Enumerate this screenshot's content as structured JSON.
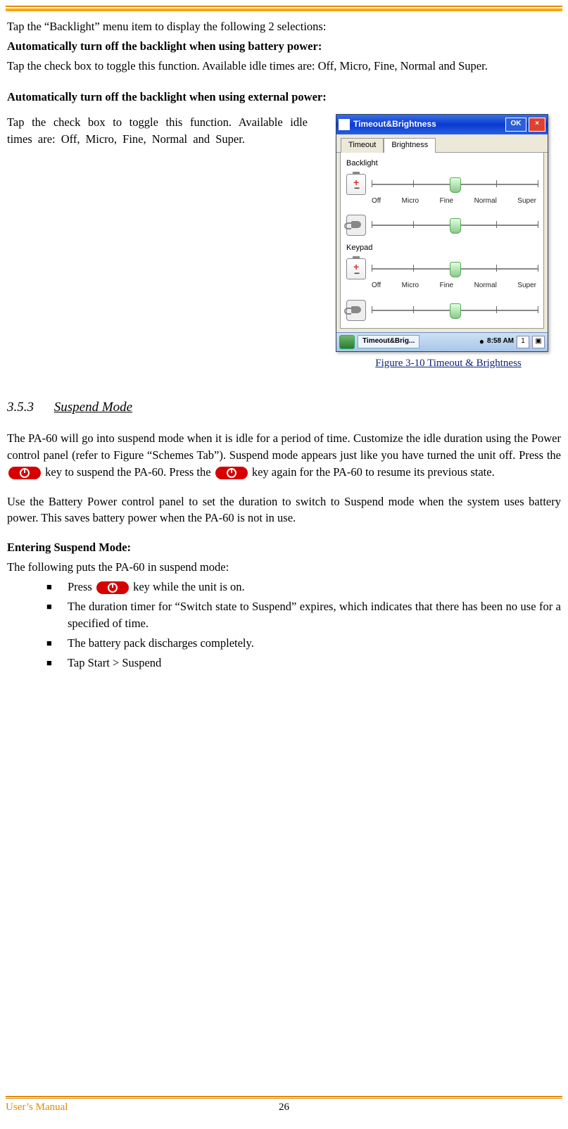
{
  "body": {
    "p1": "Tap the “Backlight” menu item to display the following 2 selections:",
    "h1": "Automatically turn off the backlight when using battery power:",
    "p2": "Tap the check box to toggle this function. Available idle times are: Off, Micro, Fine, Normal and Super.",
    "h2": "Automatically turn off the backlight when using external power:",
    "p3": "Tap the check box to toggle this function. Available idle times are: Off, Micro, Fine, Normal and Super."
  },
  "screenshot": {
    "title": "Timeout&Brightness",
    "ok": "OK",
    "close": "×",
    "tabs": {
      "timeout": "Timeout",
      "brightness": "Brightness"
    },
    "groups": {
      "backlight": "Backlight",
      "keypad": "Keypad"
    },
    "ticks": {
      "t0": "Off",
      "t1": "Micro",
      "t2": "Fine",
      "t3": "Normal",
      "t4": "Super"
    },
    "taskbar": {
      "app": "Timeout&Brig...",
      "time": "8:58 AM",
      "num": "1"
    },
    "caption": "Figure 3-10 Timeout  & Brightness"
  },
  "section": {
    "num": "3.5.3",
    "title": "Suspend Mode",
    "para1a": "The PA-60 will go into suspend mode when it is idle for a period of time. Customize the idle duration using the Power control panel (refer to Figure “Schemes Tab”). Suspend mode appears just like you have turned the unit off. Press the ",
    "para1b": " key to suspend the PA-60. Press the ",
    "para1c": " key again for the PA-60 to resume its previous state.",
    "para2": "Use the Battery Power control panel to set the duration to switch to Suspend mode when the system uses battery power. This saves battery power when the PA-60 is not in use.",
    "h3": "Entering Suspend Mode:",
    "p4": "The following puts the PA-60 in suspend mode:",
    "bullets": {
      "b1a": "Press ",
      "b1b": " key while the unit is on.",
      "b2": "The duration timer for “Switch state to Suspend” expires, which indicates that there has been no use for a specified of time.",
      "b3": "The battery pack discharges completely.",
      "b4": "Tap Start > Suspend"
    }
  },
  "footer": {
    "left": "User’s Manual",
    "page": "26"
  }
}
